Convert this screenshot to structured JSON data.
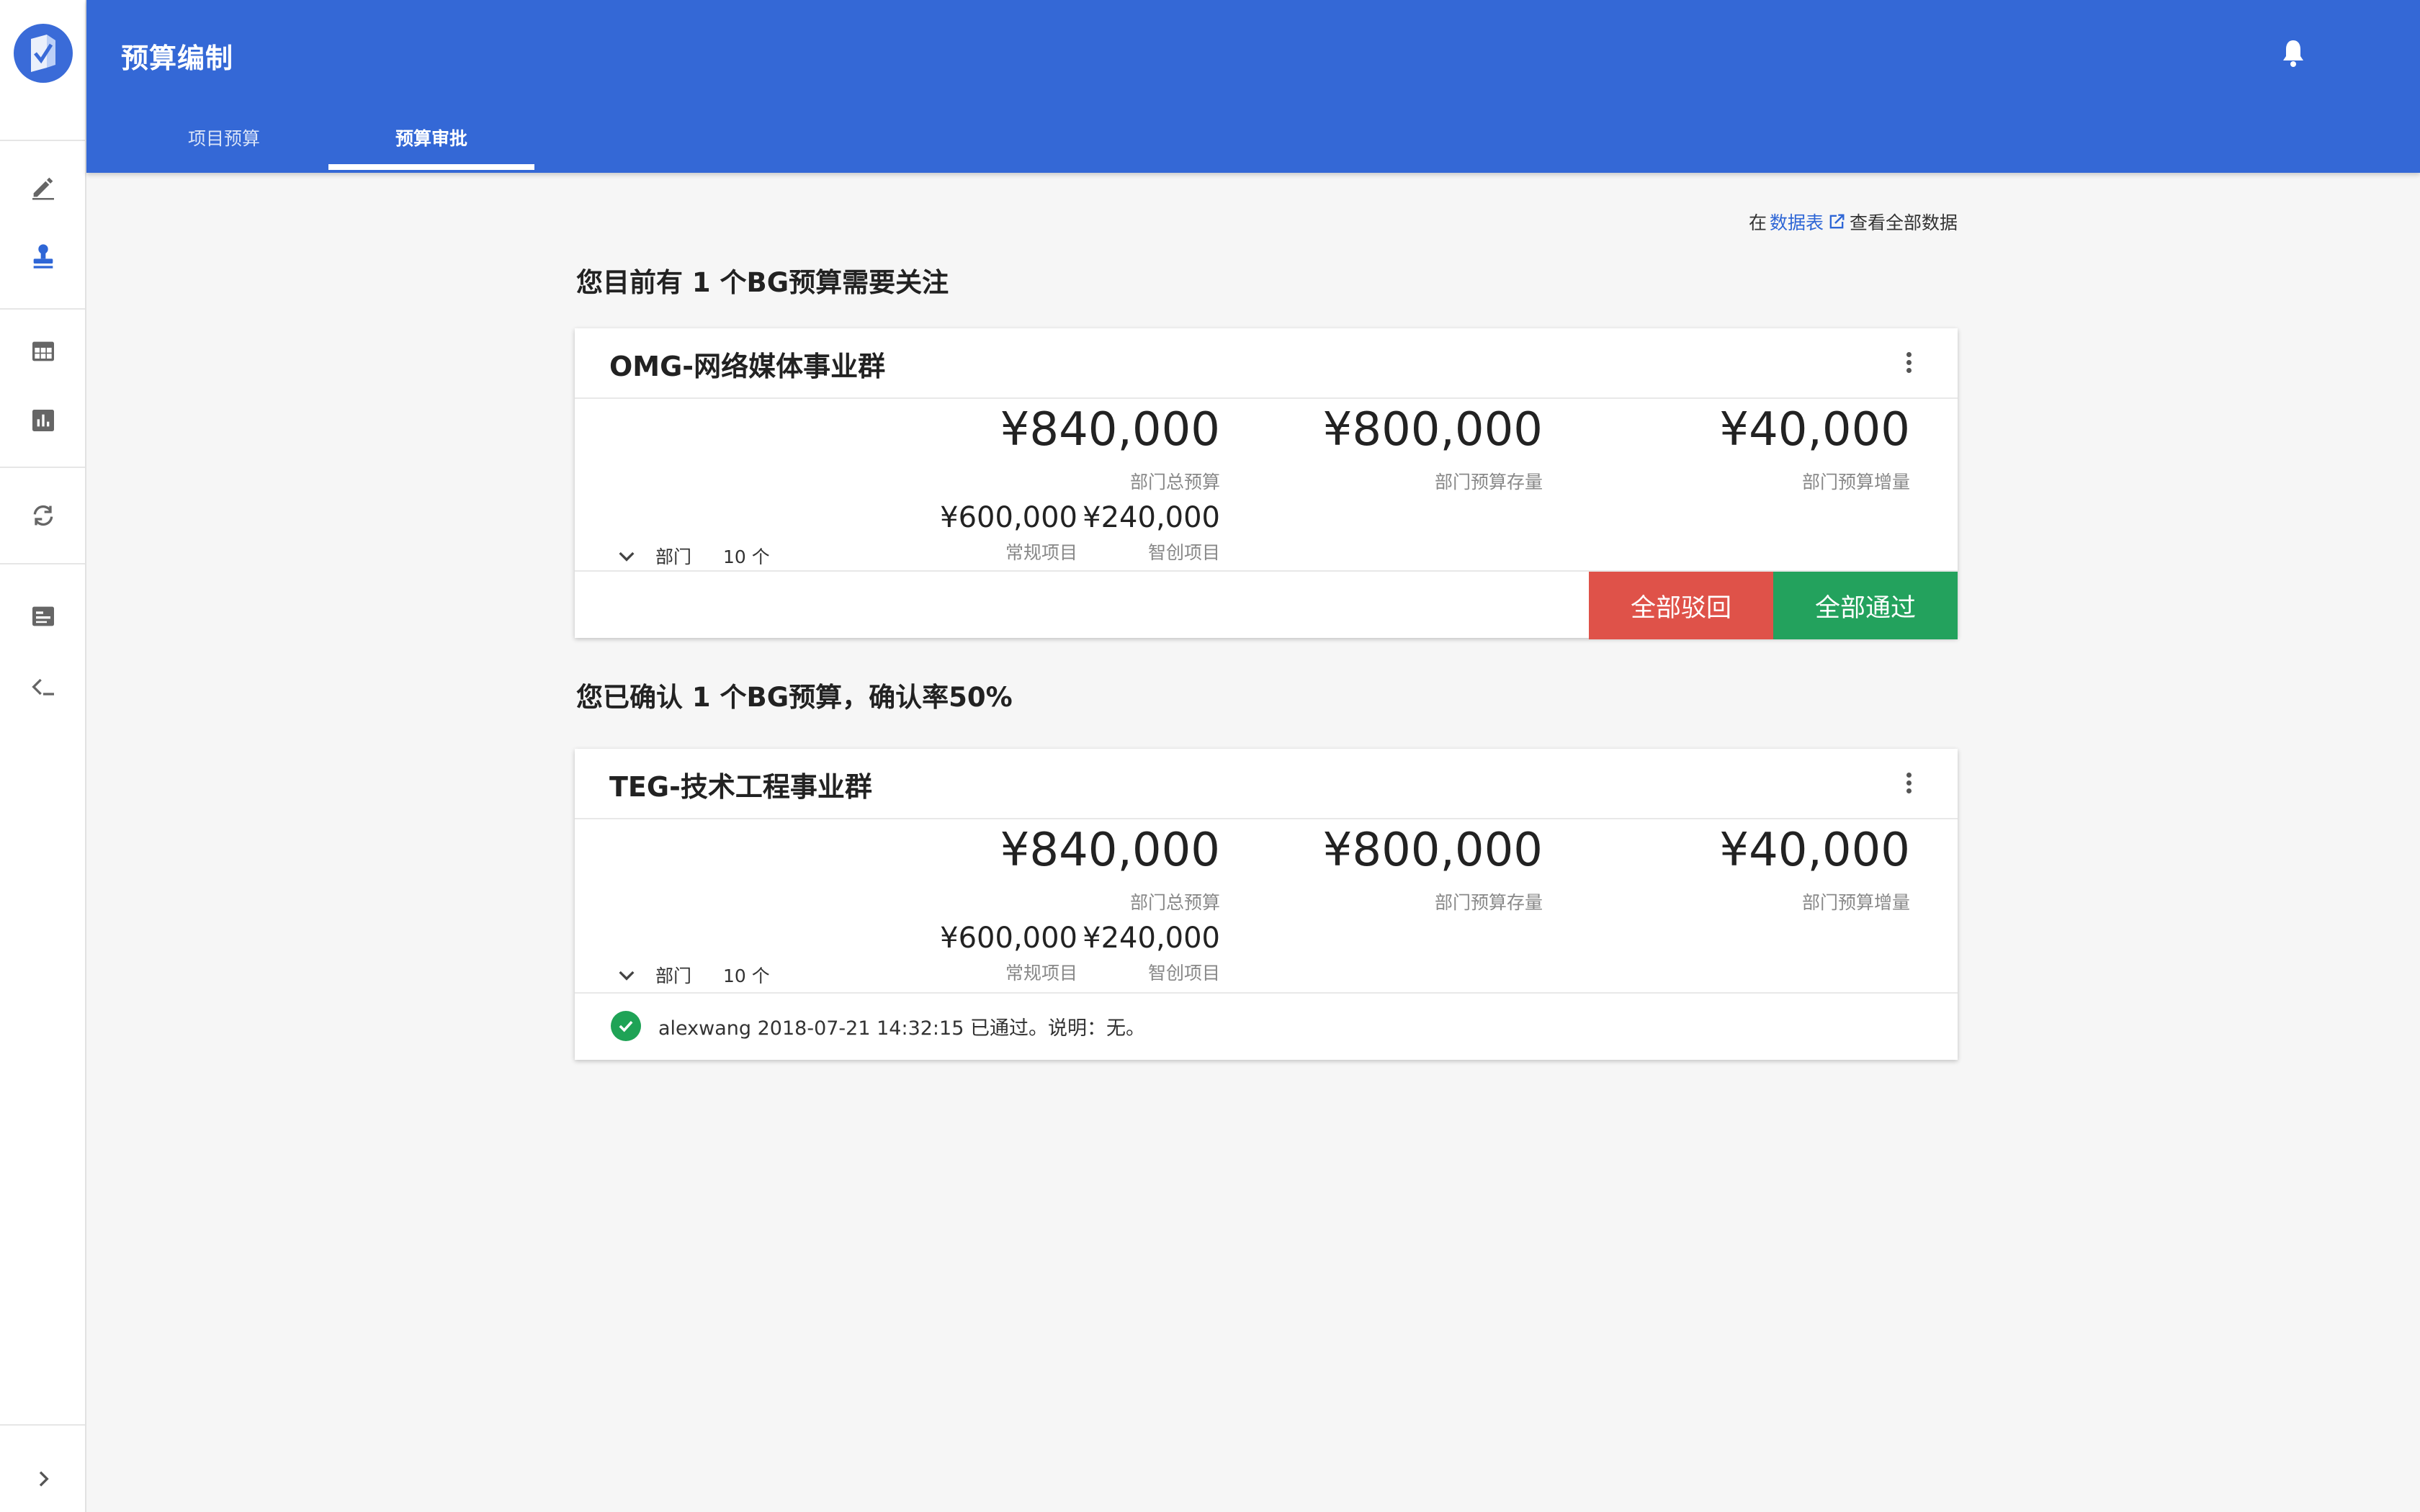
{
  "header": {
    "title": "预算编制",
    "tabs": [
      {
        "label": "项目预算"
      },
      {
        "label": "预算审批"
      }
    ],
    "active_tab": "预算审批"
  },
  "sidebar": {
    "items": [
      {
        "icon": "edit-icon"
      },
      {
        "icon": "stamp-icon",
        "active": true
      },
      {
        "icon": "table-icon"
      },
      {
        "icon": "bar-chart-icon"
      },
      {
        "icon": "sync-icon"
      },
      {
        "icon": "list-card-icon"
      },
      {
        "icon": "collapse-left-icon"
      },
      {
        "icon": "expand-chevron-icon"
      }
    ]
  },
  "topnote": {
    "prefix": "在",
    "link": "数据表",
    "suffix": "查看全部数据"
  },
  "pending": {
    "title": "您目前有 1 个BG预算需要关注",
    "card": {
      "name": "OMG-网络媒体事业群",
      "total": "¥840,000",
      "total_label": "部门总预算",
      "stock": "¥800,000",
      "stock_label": "部门预算存量",
      "increase": "¥40,000",
      "increase_label": "部门预算增量",
      "regular": "¥600,000",
      "regular_label": "常规项目",
      "smart": "¥240,000",
      "smart_label": "智创项目",
      "dept_label": "部门",
      "dept_count": "10 个",
      "reject_label": "全部驳回",
      "approve_label": "全部通过"
    }
  },
  "confirmed": {
    "title": "您已确认 1 个BG预算，确认率50%",
    "card": {
      "name": "TEG-技术工程事业群",
      "total": "¥840,000",
      "total_label": "部门总预算",
      "stock": "¥800,000",
      "stock_label": "部门预算存量",
      "increase": "¥40,000",
      "increase_label": "部门预算增量",
      "regular": "¥600,000",
      "regular_label": "常规项目",
      "smart": "¥240,000",
      "smart_label": "智创项目",
      "dept_label": "部门",
      "dept_count": "10 个",
      "status_text": "alexwang 2018-07-21 14:32:15 已通过。说明：无。"
    }
  },
  "colors": {
    "header": "#3468d6",
    "reject": "#df5249",
    "approve": "#23a25d",
    "link": "#2e66d6"
  }
}
